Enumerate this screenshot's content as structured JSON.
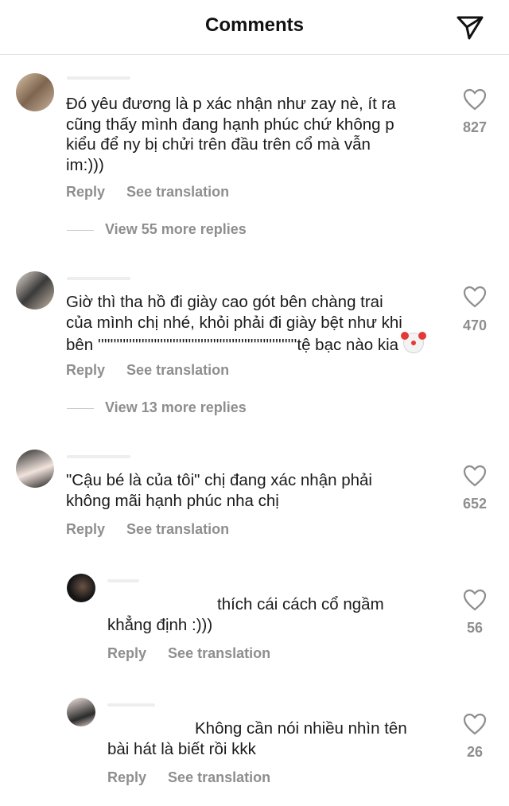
{
  "header": {
    "title": "Comments"
  },
  "comments": [
    {
      "text_lines": [
        "Đó yêu đương là p xác nhận như zay nè, ít ra",
        "cũng thấy mình đang hạnh phúc chứ không p",
        "kiểu để ny bị chửi trên đầu trên cổ mà vẫn",
        "im:)))"
      ],
      "likes": "827",
      "reply_label": "Reply",
      "translate_label": "See translation",
      "view_replies": "View 55 more replies"
    },
    {
      "text_lines": [
        "Giờ thì tha hồ đi giày cao gót bên chàng trai",
        "của mình chị nhé, khỏi phải đi giày bệt như khi",
        "bên ''''''''''''''''''''''''''''''''''''''''''''''''''''''''''''''''tệ bạc nào kia"
      ],
      "likes": "470",
      "reply_label": "Reply",
      "translate_label": "See translation",
      "view_replies": "View 13 more replies"
    },
    {
      "text_lines": [
        "\"Cậu bé là của tôi\" chị đang xác nhận phải",
        "không mãi hạnh phúc nha chị"
      ],
      "likes": "652",
      "reply_label": "Reply",
      "translate_label": "See translation"
    },
    {
      "text_lines": [
        "thích cái cách cổ ngầm",
        "khẳng định :)))"
      ],
      "likes": "56",
      "reply_label": "Reply",
      "translate_label": "See translation"
    },
    {
      "text_lines": [
        "Không cần nói nhiều nhìn tên",
        "bài hát là biết rồi kkk"
      ],
      "likes": "26",
      "reply_label": "Reply",
      "translate_label": "See translation"
    }
  ]
}
